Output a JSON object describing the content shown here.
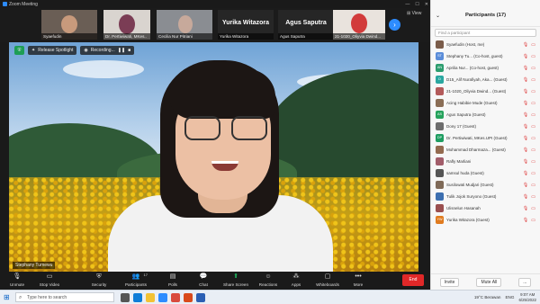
{
  "window": {
    "title": "Zoom Meeting"
  },
  "thumbnails": [
    {
      "label": "Syaefudin",
      "type": "video"
    },
    {
      "label": "Dr. Pertiwiwati, MKes..",
      "type": "video"
    },
    {
      "label": "Cecilia Nur Pitriani",
      "type": "video"
    },
    {
      "label": "Yurika Witazora",
      "big": "Yurika Witazora",
      "type": "name"
    },
    {
      "label": "Agus Saputra",
      "big": "Agus Saputra",
      "type": "name"
    },
    {
      "label": "21-1020_Oliyvia Dwind...",
      "type": "video"
    }
  ],
  "view_label": "View",
  "video": {
    "spotlight_label": "Release Spotlight",
    "recording_label": "Recording...",
    "speaker_name": "Stephany Tumewu"
  },
  "toolbar": [
    {
      "label": "Unmute",
      "icon": "microphone-muted-icon"
    },
    {
      "label": "Stop Video",
      "icon": "camera-icon"
    },
    {
      "label": "Security",
      "icon": "shield-icon"
    },
    {
      "label": "Participants",
      "icon": "participants-icon",
      "count": "17"
    },
    {
      "label": "Polls",
      "icon": "polls-icon"
    },
    {
      "label": "Chat",
      "icon": "chat-icon"
    },
    {
      "label": "Share Screen",
      "icon": "share-screen-icon"
    },
    {
      "label": "Reactions",
      "icon": "reactions-icon"
    },
    {
      "label": "Apps",
      "icon": "apps-icon"
    },
    {
      "label": "Whiteboards",
      "icon": "whiteboard-icon"
    },
    {
      "label": "More",
      "icon": "more-icon"
    }
  ],
  "end_label": "End",
  "panel": {
    "title": "Participants (17)",
    "search_placeholder": "Find a participant",
    "participants": [
      {
        "name": "Syaefudin (Host, me)",
        "initials": "",
        "color": "#7a5c4a"
      },
      {
        "name": "Stephany Tu... (Co-host, guest)",
        "initials": "ST",
        "color": "#5b8dd9"
      },
      {
        "name": "Aprilia Nur... (Co-host, guest)",
        "initials": "AN",
        "color": "#2d9d6f"
      },
      {
        "name": "D15_Alif Nurafiyah, Aka... (Guest)",
        "initials": "D",
        "color": "#2aa7a0"
      },
      {
        "name": "21-1020_Oliyvia Dwind... (Guest)",
        "initials": "",
        "color": "#b35a5a"
      },
      {
        "name": "Acing Habibie Mude (Guest)",
        "initials": "",
        "color": "#8a6d55"
      },
      {
        "name": "Agus Saputra (Guest)",
        "initials": "AS",
        "color": "#27a35d"
      },
      {
        "name": "Dony 17 (Guest)",
        "initials": "",
        "color": "#6d6d6d"
      },
      {
        "name": "Dr. Pertiwiwati, MKes.UPI (Guest)",
        "initials": "DP",
        "color": "#1f9d61"
      },
      {
        "name": "Mohammad Dharmaza... (Guest)",
        "initials": "",
        "color": "#936a4f"
      },
      {
        "name": "Rafly Marliani",
        "initials": "",
        "color": "#a25d6a"
      },
      {
        "name": "samsul huda (Guest)",
        "initials": "",
        "color": "#555"
      },
      {
        "name": "Susilowati Mudjari (Guest)",
        "initials": "",
        "color": "#7f6a58"
      },
      {
        "name": "Tulik Jojok Suryono (Guest)",
        "initials": "",
        "color": "#3d6fb0"
      },
      {
        "name": "Ulisnelun Hasanah",
        "initials": "",
        "color": "#9a4f4f"
      },
      {
        "name": "Yurika Witazora (Guest)",
        "initials": "YW",
        "color": "#e07b1f"
      }
    ],
    "invite_label": "Invite",
    "mute_all_label": "Mute All",
    "more_label": "..."
  },
  "taskbar": {
    "search_placeholder": "Type here to search",
    "weather": "19°C Berawan",
    "language": "ENG",
    "time": "9:07 AM",
    "date": "6/25/2022"
  }
}
